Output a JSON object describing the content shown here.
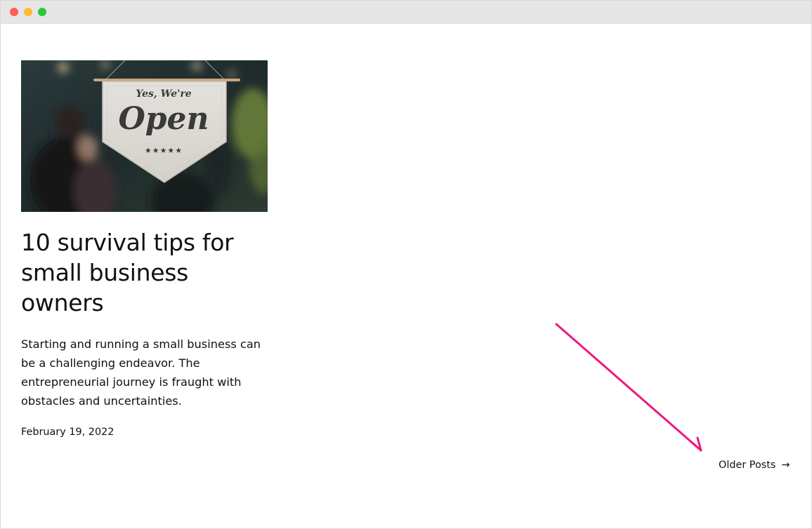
{
  "post": {
    "image_sign_line1": "Yes, We're",
    "image_sign_line2": "Open",
    "image_sign_stars": "★★★★★",
    "title": "10 survival tips for small business owners",
    "excerpt": "Starting and running a small business can be a challenging endeavor. The entrepreneurial journey is fraught with obstacles and uncertainties.",
    "date": "February 19, 2022"
  },
  "pagination": {
    "older_label": "Older Posts",
    "older_arrow": "→"
  },
  "annotation": {
    "arrow_color": "#f0177f"
  }
}
